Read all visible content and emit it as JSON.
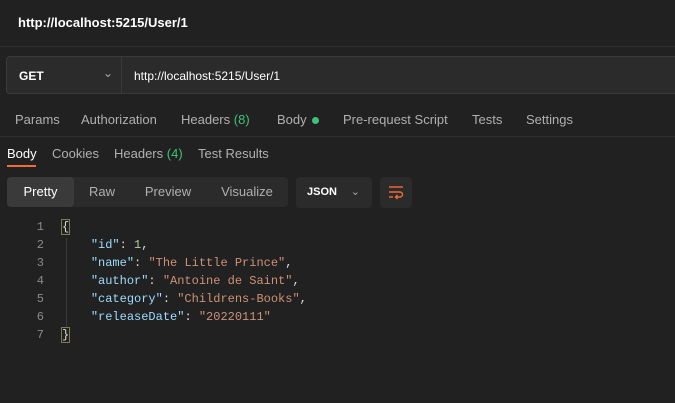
{
  "window": {
    "title": "http://localhost:5215/User/1"
  },
  "request": {
    "method": "GET",
    "url": "http://localhost:5215/User/1"
  },
  "request_tabs": {
    "params": "Params",
    "authorization": "Authorization",
    "headers": "Headers",
    "headers_count": "(8)",
    "body": "Body",
    "pre_request": "Pre-request Script",
    "tests": "Tests",
    "settings": "Settings"
  },
  "response_tabs": {
    "body": "Body",
    "cookies": "Cookies",
    "headers": "Headers",
    "headers_count": "(4)",
    "test_results": "Test Results"
  },
  "view_modes": {
    "pretty": "Pretty",
    "raw": "Raw",
    "preview": "Preview",
    "visualize": "Visualize"
  },
  "format": {
    "selected": "JSON"
  },
  "response": {
    "line_numbers": [
      "1",
      "2",
      "3",
      "4",
      "5",
      "6",
      "7"
    ],
    "open_brace": "{",
    "close_brace": "}",
    "fields": [
      {
        "key": "\"id\"",
        "value": "1",
        "sep": ","
      },
      {
        "key": "\"name\"",
        "value": "\"The Little Prince\"",
        "sep": ","
      },
      {
        "key": "\"author\"",
        "value": "\"Antoine de Saint\"",
        "sep": ","
      },
      {
        "key": "\"category\"",
        "value": "\"Childrens-Books\"",
        "sep": ","
      },
      {
        "key": "\"releaseDate\"",
        "value": "\"20220111\"",
        "sep": ""
      }
    ]
  },
  "colors": {
    "background": "#212121",
    "accent": "#f26b3a",
    "status_green": "#3cc27a",
    "json_key": "#9cdcfe",
    "json_string": "#ce9178",
    "json_number": "#b5cea8"
  }
}
